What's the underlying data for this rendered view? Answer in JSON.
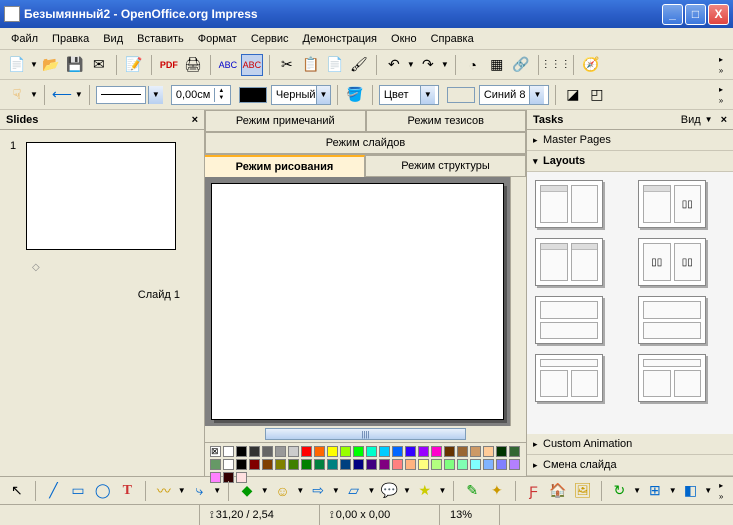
{
  "titlebar": {
    "text": "Безымянный2 - OpenOffice.org Impress"
  },
  "menu": {
    "items": [
      "Файл",
      "Правка",
      "Вид",
      "Вставить",
      "Формат",
      "Сервис",
      "Демонстрация",
      "Окно",
      "Справка"
    ]
  },
  "toolbar2": {
    "line_width": "0,00см",
    "color_black_label": "Черный",
    "fill_label": "Цвет",
    "fill_color_label": "Синий 8",
    "fill_color_hex": "#5a8ac6"
  },
  "slides_panel": {
    "title": "Slides",
    "slide_number": "1",
    "slide_label": "Слайд 1"
  },
  "view_tabs": {
    "notes": "Режим примечаний",
    "outline_top": "Режим тезисов",
    "slides": "Режим слайдов",
    "drawing": "Режим рисования",
    "structure": "Режим структуры"
  },
  "tasks_panel": {
    "title": "Tasks",
    "view_label": "Вид",
    "sections": {
      "master": "Master Pages",
      "layouts": "Layouts",
      "custom_anim": "Custom Animation",
      "slide_trans": "Смена слайда"
    }
  },
  "statusbar": {
    "pos": "31,20 / 2,54",
    "size": "0,00 x 0,00",
    "zoom": "13%"
  },
  "palette_colors": [
    "#ffffff",
    "#000000",
    "#333333",
    "#666666",
    "#999999",
    "#cccccc",
    "#ff0000",
    "#ff6600",
    "#ffff00",
    "#99ff00",
    "#00ff00",
    "#00ffcc",
    "#00ccff",
    "#0066ff",
    "#3300ff",
    "#9900ff",
    "#ff00cc",
    "#663300",
    "#996633",
    "#cc9966",
    "#ffcc99",
    "#003300",
    "#336633",
    "#669966",
    "#ffffff",
    "#000000",
    "#800000",
    "#804000",
    "#808000",
    "#408000",
    "#008000",
    "#008040",
    "#008080",
    "#004080",
    "#000080",
    "#400080",
    "#800080",
    "#ff8080",
    "#ffb380",
    "#ffff80",
    "#b3ff80",
    "#80ff80",
    "#80ffb3",
    "#80ffff",
    "#80b3ff",
    "#8080ff",
    "#b380ff",
    "#ff80ff",
    "#330000",
    "#ffe0e0"
  ]
}
